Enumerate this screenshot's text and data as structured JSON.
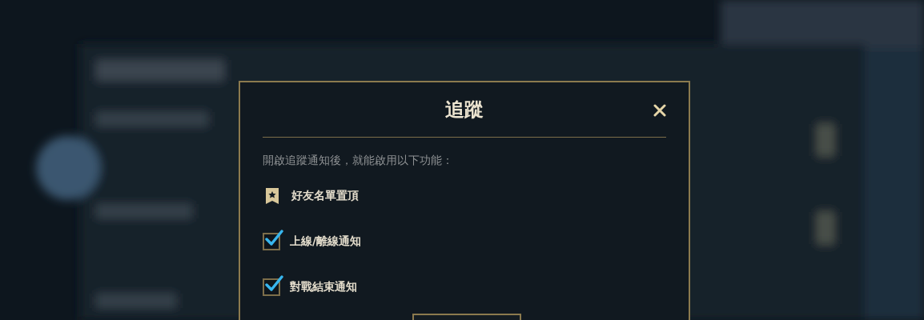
{
  "dialog": {
    "title": "追蹤",
    "intro": "開啟追蹤通知後，就能啟用以下功能：",
    "options": [
      {
        "kind": "badge",
        "label": "好友名單置頂"
      },
      {
        "kind": "checkbox",
        "label": "上線/離線通知",
        "checked": true
      },
      {
        "kind": "checkbox",
        "label": "對戰結束通知",
        "checked": true
      }
    ]
  }
}
